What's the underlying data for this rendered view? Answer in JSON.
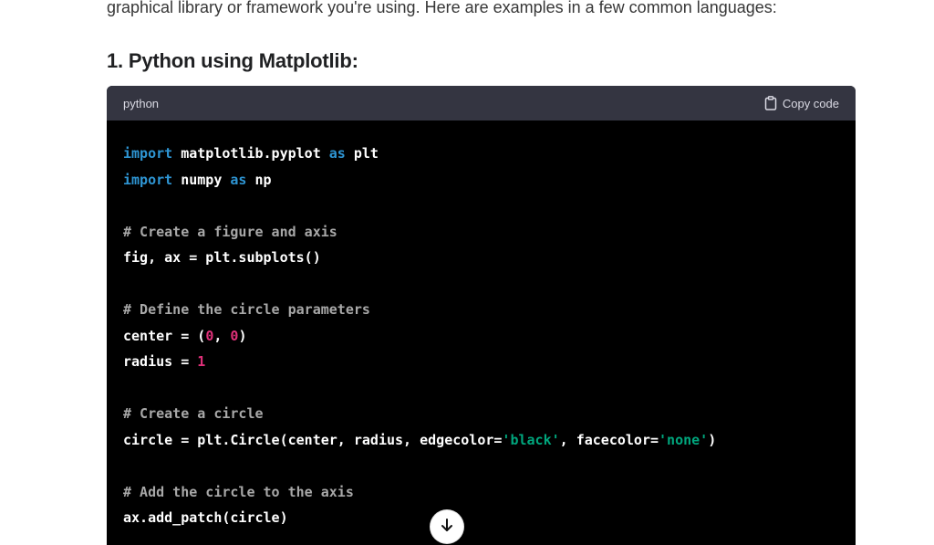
{
  "message": {
    "intro_text": "graphical library or framework you're using. Here are examples in a few common languages:",
    "section_heading": "1. Python using Matplotlib:"
  },
  "code_block": {
    "language": "python",
    "copy_label": "Copy code",
    "lines": [
      [
        {
          "t": "import",
          "k": "keyword"
        },
        {
          "t": " matplotlib.pyplot ",
          "k": "plain"
        },
        {
          "t": "as",
          "k": "keyword"
        },
        {
          "t": " plt",
          "k": "plain"
        }
      ],
      [
        {
          "t": "import",
          "k": "keyword"
        },
        {
          "t": " numpy ",
          "k": "plain"
        },
        {
          "t": "as",
          "k": "keyword"
        },
        {
          "t": " np",
          "k": "plain"
        }
      ],
      [],
      [
        {
          "t": "# Create a figure and axis",
          "k": "comment"
        }
      ],
      [
        {
          "t": "fig, ax = plt.subplots()",
          "k": "plain"
        }
      ],
      [],
      [
        {
          "t": "# Define the circle parameters",
          "k": "comment"
        }
      ],
      [
        {
          "t": "center = (",
          "k": "plain"
        },
        {
          "t": "0",
          "k": "number"
        },
        {
          "t": ", ",
          "k": "plain"
        },
        {
          "t": "0",
          "k": "number"
        },
        {
          "t": ")",
          "k": "plain"
        }
      ],
      [
        {
          "t": "radius = ",
          "k": "plain"
        },
        {
          "t": "1",
          "k": "number"
        }
      ],
      [],
      [
        {
          "t": "# Create a circle",
          "k": "comment"
        }
      ],
      [
        {
          "t": "circle = plt.Circle(center, radius, edgecolor=",
          "k": "plain"
        },
        {
          "t": "'black'",
          "k": "string"
        },
        {
          "t": ", facecolor=",
          "k": "plain"
        },
        {
          "t": "'none'",
          "k": "string"
        },
        {
          "t": ")",
          "k": "plain"
        }
      ],
      [],
      [
        {
          "t": "# Add the circle to the axis",
          "k": "comment"
        }
      ],
      [
        {
          "t": "ax.add_patch(circle)",
          "k": "plain"
        }
      ]
    ]
  },
  "icons": {
    "copy": "clipboard-icon",
    "scroll": "arrow-down-icon"
  },
  "colors": {
    "keyword": "#2e95d3",
    "comment": "#a8a8a8",
    "number": "#df3079",
    "string": "#00a67d",
    "code_background": "#000000",
    "code_header": "#343541"
  }
}
